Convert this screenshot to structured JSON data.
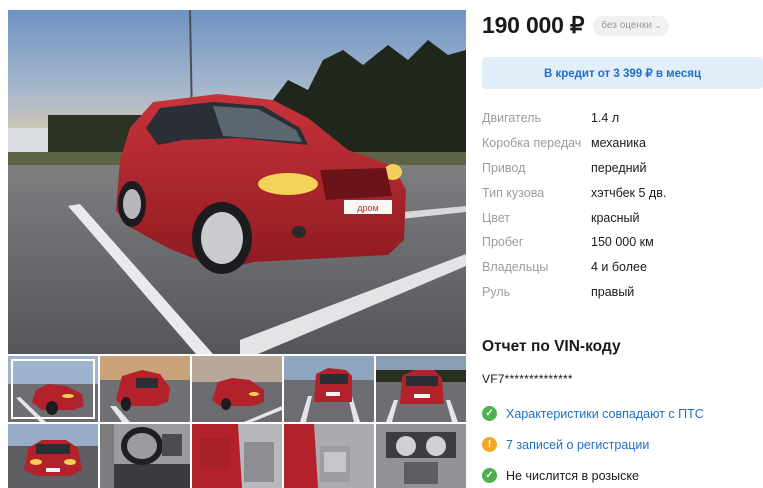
{
  "listing": {
    "price": "190 000 ₽",
    "rating_label": "без оценки",
    "credit_label": "В кредит от 3 399 ₽ в месяц"
  },
  "specs": [
    {
      "label": "Двигатель",
      "value": "1.4 л"
    },
    {
      "label": "Коробка передач",
      "value": "механика"
    },
    {
      "label": "Привод",
      "value": "передний"
    },
    {
      "label": "Тип кузова",
      "value": "хэтчбек 5 дв."
    },
    {
      "label": "Цвет",
      "value": "красный"
    },
    {
      "label": "Пробег",
      "value": "150 000 км"
    },
    {
      "label": "Владельцы",
      "value": "4 и более"
    },
    {
      "label": "Руль",
      "value": "правый"
    }
  ],
  "vin": {
    "title": "Отчет по VIN-коду",
    "code": "VF7**************",
    "checks": [
      {
        "status": "ok",
        "icon": "check-circle-icon",
        "text": "Характеристики совпадают с ПТС",
        "link": true
      },
      {
        "status": "warn",
        "icon": "exclamation-circle-icon",
        "text": "7 записей о регистрации",
        "link": true
      },
      {
        "status": "ok",
        "icon": "check-circle-icon",
        "text": "Не числится в розыске",
        "link": false
      }
    ]
  },
  "gallery": {
    "plate_text": "дром",
    "thumbnails": [
      {
        "view": "front-left",
        "active": true
      },
      {
        "view": "rear-left",
        "active": false
      },
      {
        "view": "front-left",
        "active": false
      },
      {
        "view": "rear",
        "active": false
      },
      {
        "view": "rear",
        "active": false
      },
      {
        "view": "front",
        "active": false
      },
      {
        "view": "interior-dashboard",
        "active": false
      },
      {
        "view": "interior-door",
        "active": false
      },
      {
        "view": "interior-seats",
        "active": false
      },
      {
        "view": "interior-console",
        "active": false
      }
    ]
  },
  "colors": {
    "accent_blue": "#1f6fc6",
    "credit_bg": "#e3eefb",
    "ok_green": "#4caf50",
    "warn_orange": "#f5a623",
    "car_red": "#b3222a"
  }
}
